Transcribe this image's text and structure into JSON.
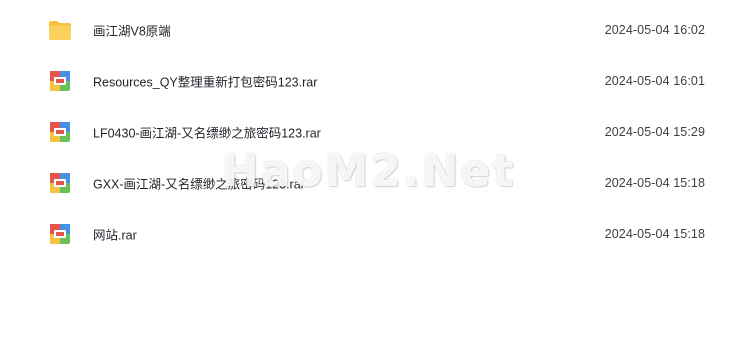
{
  "files": [
    {
      "name": "画江湖V8原端",
      "date": "2024-05-04 16:02",
      "icon": "folder-icon",
      "type": "folder"
    },
    {
      "name": "Resources_QY整理重新打包密码123.rar",
      "date": "2024-05-04 16:01",
      "icon": "rar-archive-icon",
      "type": "archive"
    },
    {
      "name": "LF0430-画江湖-又名缥缈之旅密码123.rar",
      "date": "2024-05-04 15:29",
      "icon": "rar-archive-icon",
      "type": "archive"
    },
    {
      "name": "GXX-画江湖-又名缥缈之旅密码123.rar",
      "date": "2024-05-04 15:18",
      "icon": "rar-archive-icon",
      "type": "archive"
    },
    {
      "name": "网站.rar",
      "date": "2024-05-04 15:18",
      "icon": "rar-archive-icon",
      "type": "archive"
    }
  ],
  "watermark": "HaoM2.Net",
  "colors": {
    "folder": "#F7C23E",
    "archive_red": "#E4544B",
    "archive_green": "#6BBF59",
    "archive_blue": "#4A90E2",
    "archive_yellow": "#F5C342"
  }
}
